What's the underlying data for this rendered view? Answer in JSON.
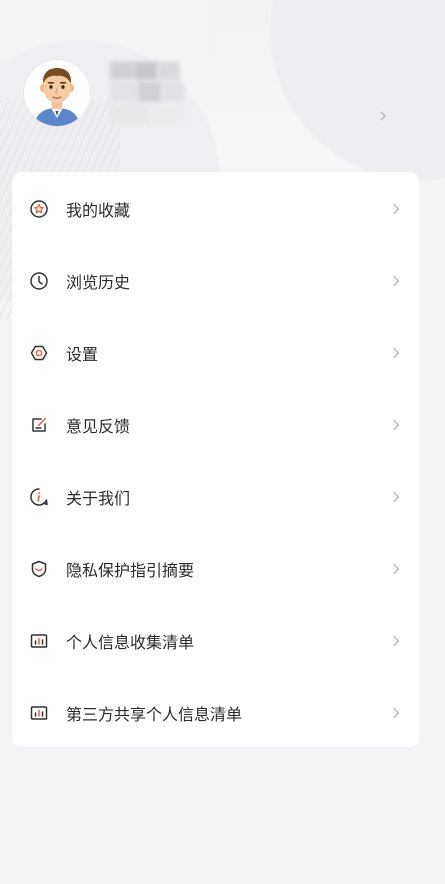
{
  "header": {
    "avatar_icon": "user-avatar-illustration",
    "chevron_icon": "chevron-right-icon"
  },
  "menu": {
    "items": [
      {
        "label": "我的收藏",
        "icon": "star-circle-icon"
      },
      {
        "label": "浏览历史",
        "icon": "clock-icon"
      },
      {
        "label": "设置",
        "icon": "hexagon-gear-icon"
      },
      {
        "label": "意见反馈",
        "icon": "feedback-edit-icon"
      },
      {
        "label": "关于我们",
        "icon": "info-circle-icon"
      },
      {
        "label": "隐私保护指引摘要",
        "icon": "shield-icon"
      },
      {
        "label": "个人信息收集清单",
        "icon": "chart-list-icon"
      },
      {
        "label": "第三方共享个人信息清单",
        "icon": "chart-list-icon"
      }
    ]
  },
  "colors": {
    "page_background": "#f4f4f6",
    "card_background": "#ffffff",
    "icon_stroke": "#333333",
    "icon_accent": "#e8603c",
    "chevron": "#b8b8bf"
  }
}
